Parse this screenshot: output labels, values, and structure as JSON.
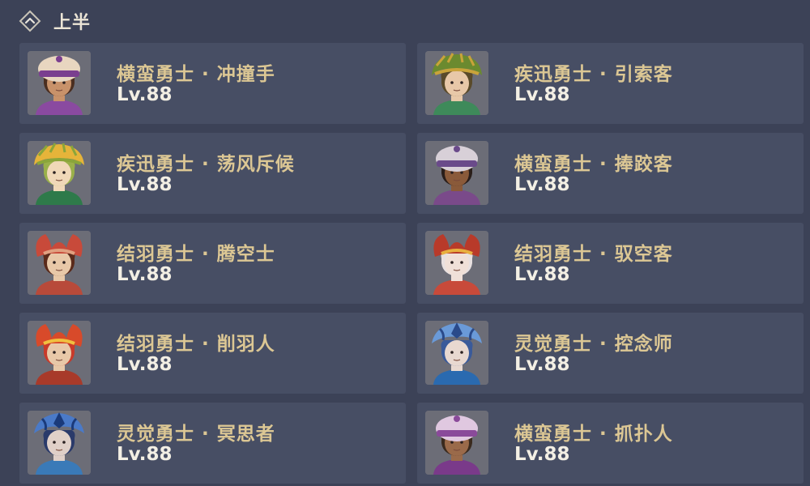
{
  "section": {
    "title": "上半",
    "icon": "collapse-up-icon"
  },
  "enemies": [
    {
      "name": "横蛮勇士 · 冲撞手",
      "level": "Lv.88",
      "icon": "hat-warrior-portrait",
      "hat": "#e8d6c0",
      "band": "#7a3f8f",
      "skin": "#c8926a",
      "hair": "#4a2e20",
      "shirt": "#8a4aa0"
    },
    {
      "name": "疾迅勇士 · 引索客",
      "level": "Lv.88",
      "icon": "leaf-warrior-portrait",
      "hat": "#6b8a2f",
      "band": "#c9a33a",
      "skin": "#e8c8a8",
      "hair": "#5a4a2a",
      "shirt": "#3e8a5a"
    },
    {
      "name": "疾迅勇士 · 荡风斥候",
      "level": "Lv.88",
      "icon": "leaf-warrior-portrait",
      "hat": "#e6b43a",
      "band": "#8aa53a",
      "skin": "#f0d8b8",
      "hair": "#9ab04a",
      "shirt": "#2e7a4a"
    },
    {
      "name": "横蛮勇士 · 捧跤客",
      "level": "Lv.88",
      "icon": "hat-warrior-portrait",
      "hat": "#d8d0d8",
      "band": "#6a4a8a",
      "skin": "#8a5a3a",
      "hair": "#2a1e1a",
      "shirt": "#7a4a8a"
    },
    {
      "name": "结羽勇士 · 腾空士",
      "level": "Lv.88",
      "icon": "feather-warrior-portrait",
      "hat": "#c84a3a",
      "band": "#e0a080",
      "skin": "#e8c8a8",
      "hair": "#5a2a1a",
      "shirt": "#b84a3a"
    },
    {
      "name": "结羽勇士 · 驭空客",
      "level": "Lv.88",
      "icon": "feather-warrior-portrait",
      "hat": "#b83a2a",
      "band": "#e8b040",
      "skin": "#f0e0d8",
      "hair": "#e8e0e0",
      "shirt": "#c84a3a"
    },
    {
      "name": "结羽勇士 · 削羽人",
      "level": "Lv.88",
      "icon": "feather-warrior-portrait",
      "hat": "#d84a2a",
      "band": "#f0c040",
      "skin": "#e8c8a8",
      "hair": "#c83a2a",
      "shirt": "#a83a2a"
    },
    {
      "name": "灵觉勇士 · 控念师",
      "level": "Lv.88",
      "icon": "spirit-warrior-portrait",
      "hat": "#6a9ad8",
      "band": "#2a4a8a",
      "skin": "#e8d8d0",
      "hair": "#3a5a9a",
      "shirt": "#2a6ab0"
    },
    {
      "name": "灵觉勇士 · 冥思者",
      "level": "Lv.88",
      "icon": "spirit-warrior-portrait",
      "hat": "#4a7ac8",
      "band": "#1a3a7a",
      "skin": "#e0d0c8",
      "hair": "#2a3a6a",
      "shirt": "#3a7ab8"
    },
    {
      "name": "横蛮勇士 · 抓扑人",
      "level": "Lv.88",
      "icon": "hat-warrior-portrait",
      "hat": "#e0c8e0",
      "band": "#8a4a9a",
      "skin": "#9a6a4a",
      "hair": "#3a2a1e",
      "shirt": "#7a3a8a"
    }
  ]
}
